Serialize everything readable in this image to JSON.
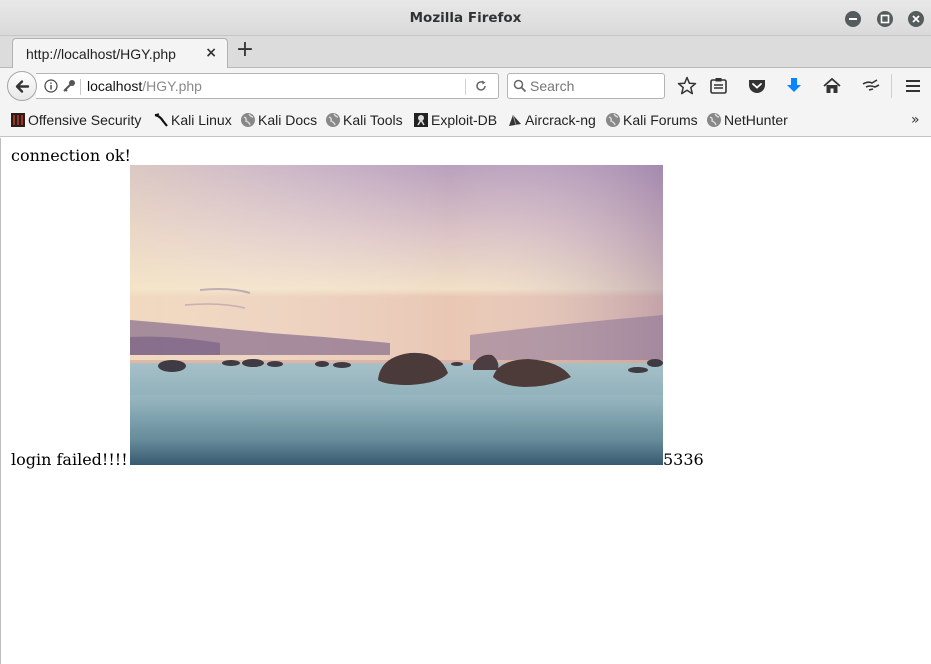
{
  "window": {
    "title": "Mozilla Firefox"
  },
  "tabs": [
    {
      "label": "http://localhost/HGY.php",
      "close_glyph": "×"
    }
  ],
  "new_tab_glyph": "+",
  "url": {
    "host": "localhost",
    "path": "/HGY.php"
  },
  "search": {
    "placeholder": "Search"
  },
  "bookmarks": [
    {
      "label": "Offensive Security",
      "icon": "offsec-icon"
    },
    {
      "label": "Kali Linux",
      "icon": "kali-dragon-icon"
    },
    {
      "label": "Kali Docs",
      "icon": "globe-icon"
    },
    {
      "label": "Kali Tools",
      "icon": "globe-icon"
    },
    {
      "label": "Exploit-DB",
      "icon": "exploitdb-icon"
    },
    {
      "label": "Aircrack-ng",
      "icon": "aircrack-icon"
    },
    {
      "label": "Kali Forums",
      "icon": "globe-icon"
    },
    {
      "label": "NetHunter",
      "icon": "globe-icon"
    }
  ],
  "bookmarks_overflow": "»",
  "page": {
    "connection_text": "connection ok!",
    "login_text": "login failed!!!!",
    "number_text": "5336"
  },
  "colors": {
    "download_arrow": "#0a84ff",
    "window_button": "#555c5e"
  }
}
